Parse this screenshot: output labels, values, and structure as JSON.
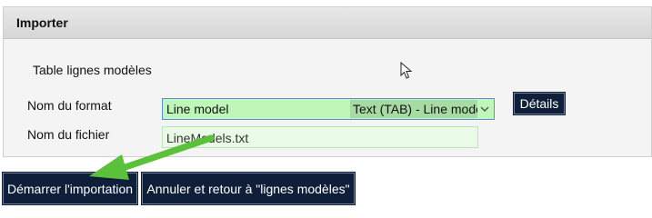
{
  "panel": {
    "title": "Importer"
  },
  "form": {
    "section_label": "Table lignes modèles",
    "format_label": "Nom du format",
    "format_value": "Line model",
    "format_extra": "Text (TAB) - Line model",
    "details_button": "Détails",
    "file_label": "Nom du fichier",
    "file_value": "LineModels.txt"
  },
  "actions": {
    "start_import": "Démarrer l'importation",
    "cancel_return": "Annuler et retour à \"lignes modèles\""
  },
  "colors": {
    "dark_button": "#0f1f3a",
    "select_bg": "#bff7b8",
    "annotation_arrow": "#5cc13a"
  },
  "icons": {
    "select_chevron": "chevron-down-icon",
    "cursor": "mouse-pointer-icon",
    "annotation": "annotation-arrow"
  }
}
